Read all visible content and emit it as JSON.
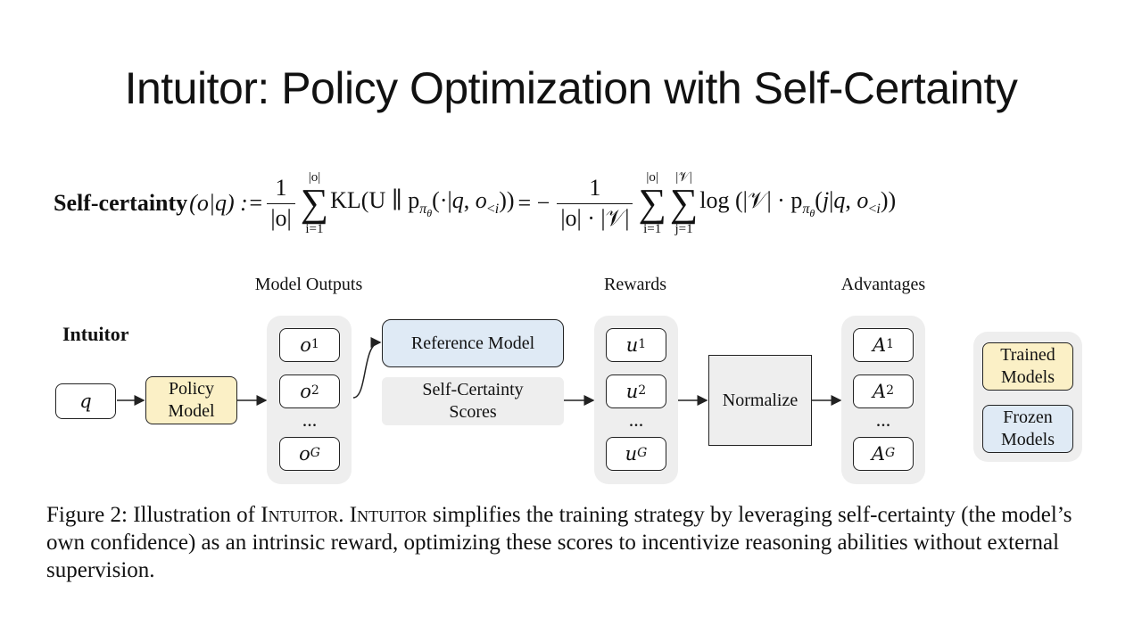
{
  "title": "Intuitor: Policy Optimization with Self-Certainty",
  "formula": {
    "lhs_name": "Self-certainty",
    "lhs_args": "(o|q) :=",
    "frac1_num": "1",
    "frac1_den": "|o|",
    "sum1_upper": "|o|",
    "sum1_lower": "i=1",
    "kl_term": "KL(U ∥ p",
    "eq_minus": "= −",
    "frac2_num": "1",
    "frac2_den": "|o| · |𝒱|",
    "sum2_upper": "|o|",
    "sum2_lower": "i=1",
    "sum3_upper": "|𝒱|",
    "sum3_lower": "j=1",
    "log_term": "log (|𝒱| · p"
  },
  "diagram": {
    "header_outputs": "Model Outputs",
    "header_rewards": "Rewards",
    "header_advantages": "Advantages",
    "intuitor_label": "Intuitor",
    "input_q": "q",
    "policy_model": [
      "Policy",
      "Model"
    ],
    "outputs": [
      "o",
      "o",
      "o"
    ],
    "output_subs": [
      "1",
      "2",
      "G"
    ],
    "reference_model": "Reference Model",
    "self_certainty": [
      "Self-Certainty",
      "Scores"
    ],
    "rewards": [
      "u",
      "u",
      "u"
    ],
    "reward_subs": [
      "1",
      "2",
      "G"
    ],
    "normalize": "Normalize",
    "advantages": [
      "A",
      "A",
      "A"
    ],
    "advantage_subs": [
      "1",
      "2",
      "G"
    ],
    "ellipsis": "...",
    "legend": {
      "trained": [
        "Trained",
        "Models"
      ],
      "frozen": [
        "Frozen",
        "Models"
      ],
      "trained_color": "#fbf0c6",
      "frozen_color": "#dfeaf5"
    }
  },
  "caption": {
    "prefix": "Figure 2: Illustration of ",
    "name1": "Intuitor",
    "mid": ". ",
    "name2": "Intuitor",
    "rest": " simplifies the training strategy by leveraging self-certainty (the model’s own confidence) as an intrinsic reward, optimizing these scores to incentivize reasoning abilities without external supervision."
  }
}
